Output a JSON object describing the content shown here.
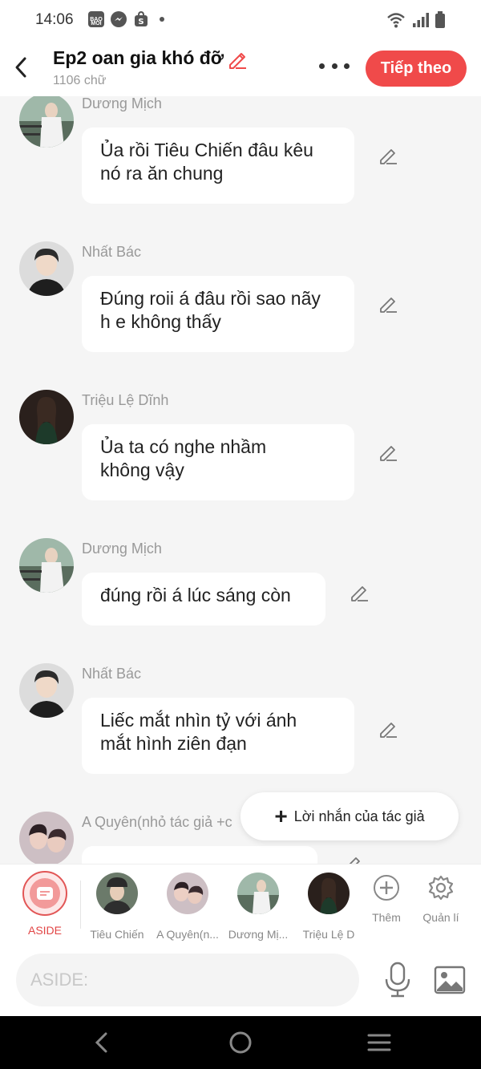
{
  "status_bar": {
    "time": "14:06",
    "icons": [
      "bao-moi-icon",
      "messenger-icon",
      "shopee-icon",
      "dot-icon",
      "wifi-icon",
      "signal-icon",
      "battery-icon"
    ],
    "bao_moi_text_1": "BAO",
    "bao_moi_text_2": "MOI"
  },
  "header": {
    "title": "Ep2 oan gia khó đỡ",
    "word_count": "1106 chữ",
    "next_label": "Tiếp theo"
  },
  "messages": [
    {
      "sender": "Dương Mịch",
      "text_lines": [
        "Ủa rồi Tiêu Chiến đâu kêu",
        "nó ra ăn chung"
      ]
    },
    {
      "sender": "Nhất Bác",
      "text_lines": [
        "Đúng roii á đâu rồi sao nãy",
        "h e không thấy"
      ]
    },
    {
      "sender": "Triệu Lệ Dĩnh",
      "text_lines": [
        "Ủa ta có nghe nhầm",
        "không vậy"
      ]
    },
    {
      "sender": "Dương Mịch",
      "text_lines": [
        "đúng rồi á lúc sáng còn"
      ]
    },
    {
      "sender": "Nhất Bác",
      "text_lines": [
        "Liếc mắt nhìn tỷ với ánh",
        "mắt hình ziên đạn"
      ]
    },
    {
      "sender": "A Quyên(nhỏ tác giả +c",
      "text_lines": []
    }
  ],
  "author_note": {
    "label": "Lời nhắn của tác giả"
  },
  "characters": [
    {
      "label": "ASIDE"
    },
    {
      "label": "Tiêu Chiến"
    },
    {
      "label": "A Quyên(n..."
    },
    {
      "label": "Dương Mị..."
    },
    {
      "label": "Triệu Lệ D"
    }
  ],
  "tools": {
    "add_label": "Thêm",
    "manage_label": "Quản lí"
  },
  "input": {
    "placeholder": "ASIDE:"
  },
  "colors": {
    "accent": "#f04a4a",
    "background": "#f5f5f5",
    "bubble": "#ffffff",
    "muted_text": "#999999"
  }
}
